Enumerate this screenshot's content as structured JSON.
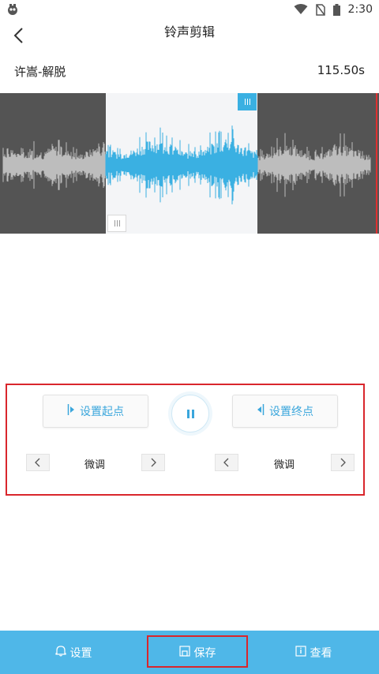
{
  "status_bar": {
    "time": "2:30"
  },
  "header": {
    "title": "铃声剪辑"
  },
  "song": {
    "name": "许嵩-解脱",
    "duration": "115.50s"
  },
  "waveform": {
    "selection_start_fraction": 0.28,
    "selection_end_fraction": 0.68
  },
  "controls": {
    "set_start_label": "设置起点",
    "set_end_label": "设置终点",
    "fine_tune_left_label": "微调",
    "fine_tune_right_label": "微调"
  },
  "bottom_bar": {
    "settings_label": "设置",
    "save_label": "保存",
    "view_label": "查看"
  },
  "colors": {
    "accent": "#3aa6dc",
    "bottom_bar": "#4fb7e8",
    "highlight_border": "#d9262c",
    "wave_selected": "#3ab0e2",
    "wave_unselected": "#bdbdbd"
  }
}
